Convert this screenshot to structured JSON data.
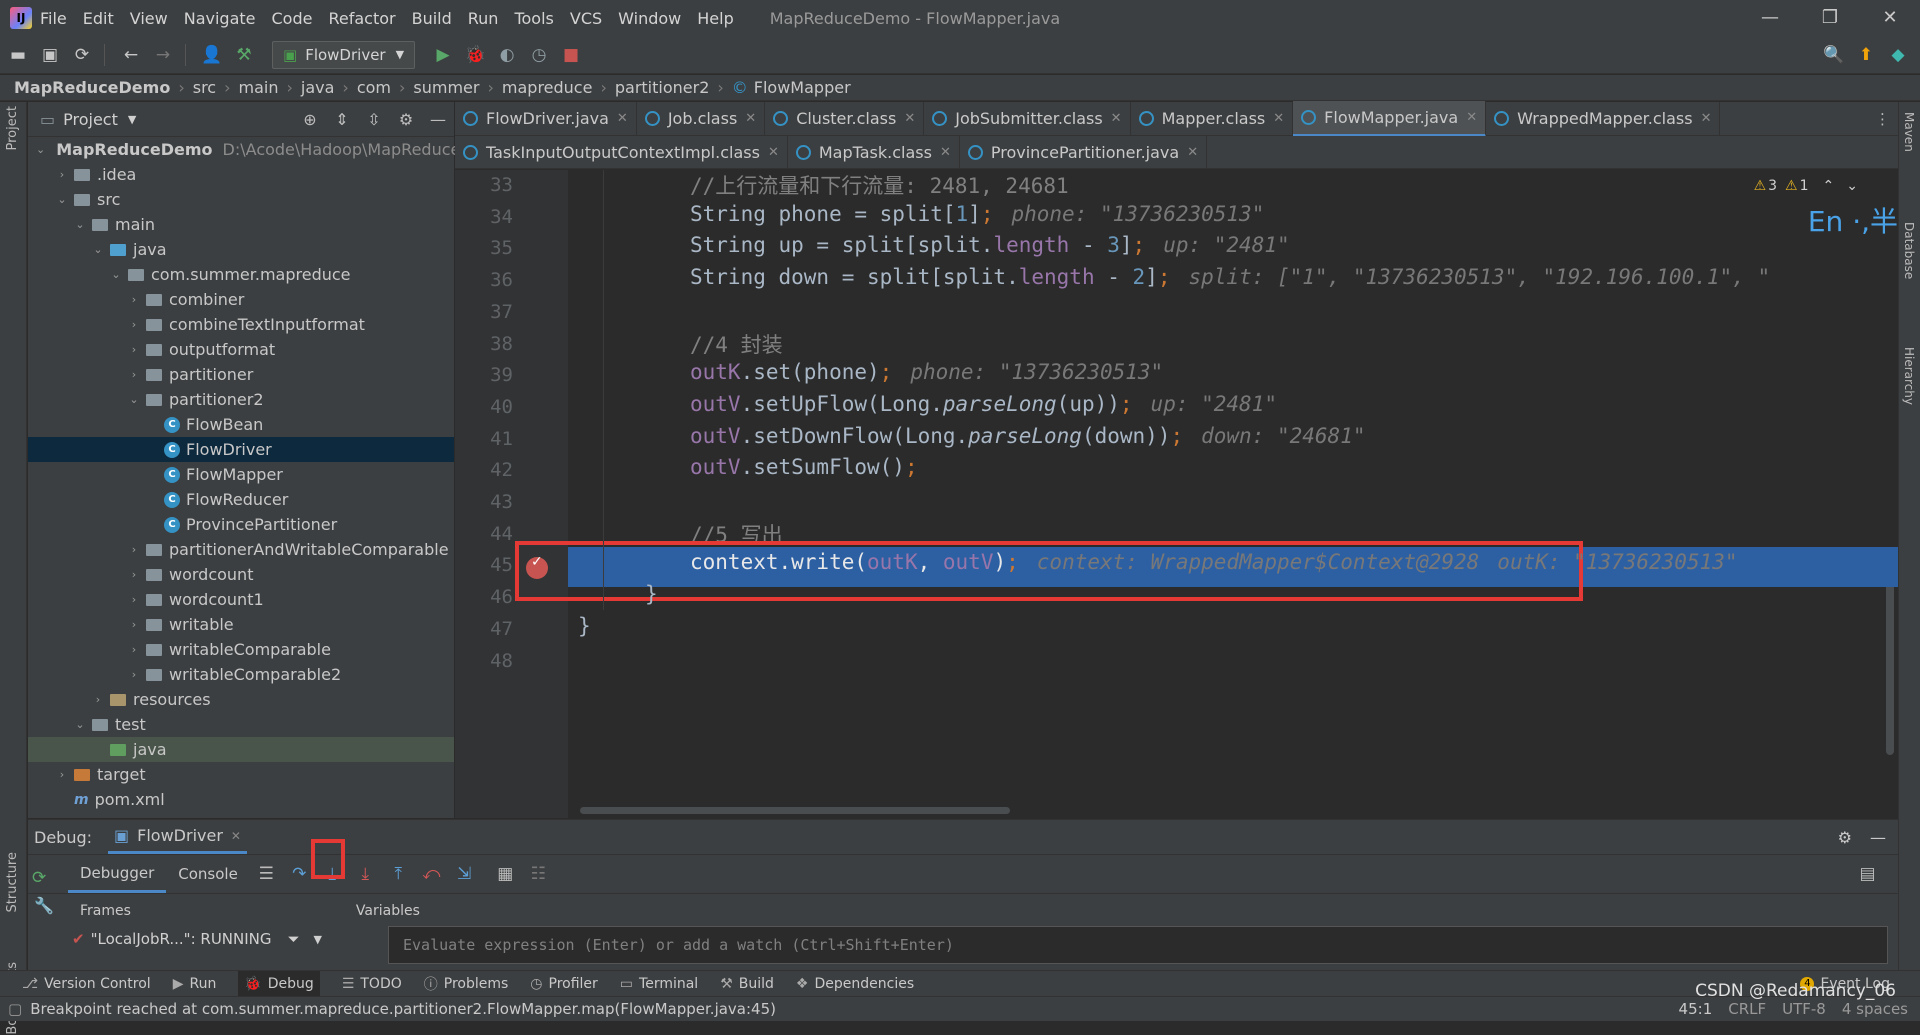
{
  "window": {
    "app_icon": "intellij-logo",
    "title": "MapReduceDemo - FlowMapper.java",
    "menu": [
      "File",
      "Edit",
      "View",
      "Navigate",
      "Code",
      "Refactor",
      "Build",
      "Run",
      "Tools",
      "VCS",
      "Window",
      "Help"
    ],
    "controls": {
      "minimize": "—",
      "maximize": "❐",
      "close": "✕"
    }
  },
  "toolbar": {
    "run_config": "FlowDriver",
    "icons": [
      "open-icon",
      "save-icon",
      "sync-icon",
      "back-icon",
      "forward-icon",
      "vcs-user-icon",
      "build-hammer-icon"
    ],
    "run_icons": [
      "run-icon",
      "debug-icon",
      "coverage-icon",
      "profile-icon",
      "stop-icon"
    ],
    "right_icons": [
      "search-icon",
      "update-icon",
      "plugin-icon"
    ]
  },
  "breadcrumb": [
    "MapReduceDemo",
    "src",
    "main",
    "java",
    "com",
    "summer",
    "mapreduce",
    "partitioner2",
    "FlowMapper"
  ],
  "left_strip": {
    "project": "Project",
    "structure": "Structure",
    "bookmarks": "Bookmarks"
  },
  "right_strip": {
    "maven": "Maven",
    "database": "Database",
    "hierarchy": "Hierarchy"
  },
  "project_panel": {
    "title": "Project",
    "tree": [
      {
        "label": "MapReduceDemo",
        "path": "D:\\Acode\\Hadoop\\MapReduceD",
        "depth": 0,
        "open": true,
        "icon": "folder",
        "bold": true
      },
      {
        "label": ".idea",
        "depth": 1,
        "open": false,
        "icon": "folder"
      },
      {
        "label": "src",
        "depth": 1,
        "open": true,
        "icon": "folder"
      },
      {
        "label": "main",
        "depth": 2,
        "open": true,
        "icon": "folder"
      },
      {
        "label": "java",
        "depth": 3,
        "open": true,
        "icon": "java"
      },
      {
        "label": "com.summer.mapreduce",
        "depth": 4,
        "open": true,
        "icon": "pkg"
      },
      {
        "label": "combiner",
        "depth": 5,
        "open": false,
        "icon": "pkg"
      },
      {
        "label": "combineTextInputformat",
        "depth": 5,
        "open": false,
        "icon": "pkg"
      },
      {
        "label": "outputformat",
        "depth": 5,
        "open": false,
        "icon": "pkg"
      },
      {
        "label": "partitioner",
        "depth": 5,
        "open": false,
        "icon": "pkg"
      },
      {
        "label": "partitioner2",
        "depth": 5,
        "open": true,
        "icon": "pkg"
      },
      {
        "label": "FlowBean",
        "depth": 6,
        "icon": "class"
      },
      {
        "label": "FlowDriver",
        "depth": 6,
        "icon": "class",
        "selected": true
      },
      {
        "label": "FlowMapper",
        "depth": 6,
        "icon": "class"
      },
      {
        "label": "FlowReducer",
        "depth": 6,
        "icon": "class"
      },
      {
        "label": "ProvincePartitioner",
        "depth": 6,
        "icon": "class"
      },
      {
        "label": "partitionerAndWritableComparable",
        "depth": 5,
        "open": false,
        "icon": "pkg"
      },
      {
        "label": "wordcount",
        "depth": 5,
        "open": false,
        "icon": "pkg"
      },
      {
        "label": "wordcount1",
        "depth": 5,
        "open": false,
        "icon": "pkg"
      },
      {
        "label": "writable",
        "depth": 5,
        "open": false,
        "icon": "pkg"
      },
      {
        "label": "writableComparable",
        "depth": 5,
        "open": false,
        "icon": "pkg"
      },
      {
        "label": "writableComparable2",
        "depth": 5,
        "open": false,
        "icon": "pkg"
      },
      {
        "label": "resources",
        "depth": 3,
        "open": false,
        "icon": "res"
      },
      {
        "label": "test",
        "depth": 2,
        "open": true,
        "icon": "folder"
      },
      {
        "label": "java",
        "depth": 3,
        "icon": "tj",
        "testsel": true
      },
      {
        "label": "target",
        "depth": 1,
        "open": false,
        "icon": "tgt"
      },
      {
        "label": "pom.xml",
        "depth": 1,
        "icon": "mvn"
      }
    ]
  },
  "editor_tabs": {
    "row1": [
      {
        "label": "FlowDriver.java",
        "active": false
      },
      {
        "label": "Job.class",
        "active": false
      },
      {
        "label": "Cluster.class",
        "active": false
      },
      {
        "label": "JobSubmitter.class",
        "active": false
      },
      {
        "label": "Mapper.class",
        "active": false
      },
      {
        "label": "FlowMapper.java",
        "active": true
      },
      {
        "label": "WrappedMapper.class",
        "active": false
      }
    ],
    "row2": [
      {
        "label": "TaskInputOutputContextImpl.class",
        "active": false
      },
      {
        "label": "MapTask.class",
        "active": false
      },
      {
        "label": "ProvincePartitioner.java",
        "active": false
      }
    ]
  },
  "inspections": {
    "warnings": "3",
    "weak_warnings": "1"
  },
  "ime_indicator": "En ·,半",
  "editor": {
    "lines": [
      {
        "n": "33",
        "html": "<span class=\"cmt\">//上行流量和下行流量: 2481, 24681</span>"
      },
      {
        "n": "34",
        "html": "String phone = split[<span class=\"num\">1</span>]<span class=\"kw\">;</span><span class=\"hint\">phone: \"13736230513\"</span>"
      },
      {
        "n": "35",
        "html": "String up = split[split.<span class=\"fld\">length</span> - <span class=\"num\">3</span>]<span class=\"kw\">;</span><span class=\"hint\">up: \"2481\"</span>"
      },
      {
        "n": "36",
        "html": "String down = split[split.<span class=\"fld\">length</span> - <span class=\"num\">2</span>]<span class=\"kw\">;</span><span class=\"hint\">split: [\"1\", \"13736230513\", \"192.196.100.1\", \"</span>"
      },
      {
        "n": "37",
        "html": ""
      },
      {
        "n": "38",
        "html": "<span class=\"cmt\">//4 封装</span>"
      },
      {
        "n": "39",
        "html": "<span class=\"fld\">outK</span>.set(phone)<span class=\"kw\">;</span><span class=\"hint\">phone: \"13736230513\"</span>"
      },
      {
        "n": "40",
        "html": "<span class=\"fld\">outV</span>.setUpFlow(Long.<span class=\"it\">parseLong</span>(up))<span class=\"kw\">;</span><span class=\"hint\">up: \"2481\"</span>"
      },
      {
        "n": "41",
        "html": "<span class=\"fld\">outV</span>.setDownFlow(Long.<span class=\"it\">parseLong</span>(down))<span class=\"kw\">;</span><span class=\"hint\">down: \"24681\"</span>"
      },
      {
        "n": "42",
        "html": "<span class=\"fld\">outV</span>.setSumFlow()<span class=\"kw\">;</span>"
      },
      {
        "n": "43",
        "html": ""
      },
      {
        "n": "44",
        "html": "<span class=\"cmt\">//5 写出</span>"
      },
      {
        "n": "45",
        "html": "context.write(<span class=\"fld\">outK</span>, <span class=\"fld\">outV</span>)<span class=\"kw\">;</span><span class=\"hint\">context: WrappedMapper$Context@2928</span><span class=\"hint\">outK: \"13736230513\"</span>",
        "current": true
      },
      {
        "n": "46",
        "html": "}",
        "indent": "brace1"
      },
      {
        "n": "47",
        "html": "}",
        "indent": "brace0"
      },
      {
        "n": "48",
        "html": ""
      }
    ]
  },
  "debug": {
    "label": "Debug:",
    "session": "FlowDriver",
    "subtabs": [
      "Debugger",
      "Console"
    ],
    "frames_label": "Frames",
    "variables_label": "Variables",
    "thread": "\"LocalJobR...\": RUNNING",
    "eval_placeholder": "Evaluate expression (Enter) or add a watch (Ctrl+Shift+Enter)"
  },
  "bottom_tools": [
    "Version Control",
    "Run",
    "Debug",
    "TODO",
    "Problems",
    "Profiler",
    "Terminal",
    "Build",
    "Dependencies"
  ],
  "event_log": {
    "count": "4",
    "label": "Event Log"
  },
  "status": {
    "message": "Breakpoint reached at com.summer.mapreduce.partitioner2.FlowMapper.map(FlowMapper.java:45)",
    "position": "45:1",
    "line_sep": "CRLF",
    "encoding": "UTF-8",
    "indent": "4 spaces",
    "watermark": "CSDN @Redamancy_06"
  },
  "colors": {
    "accent": "#4a88c7",
    "current_line": "#2d5fa3",
    "breakpoint": "#c75450",
    "highlight_box": "#e53935"
  }
}
